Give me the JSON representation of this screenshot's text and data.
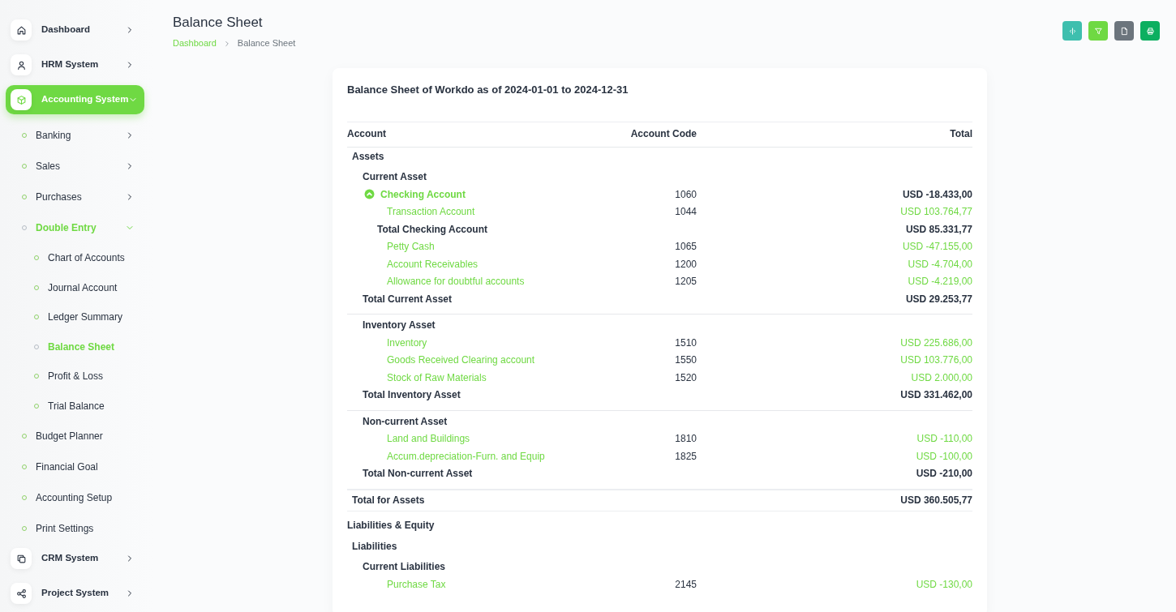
{
  "sidebar": {
    "items": [
      {
        "kind": "module",
        "label": "Dashboard",
        "selected": false,
        "expanded": false
      },
      {
        "kind": "module",
        "label": "HRM System",
        "selected": false,
        "expanded": false
      },
      {
        "kind": "module",
        "label": "Accounting System",
        "selected": true,
        "expanded": true,
        "children": [
          {
            "label": "Banking",
            "selected": false,
            "expanded": false
          },
          {
            "label": "Sales",
            "selected": false,
            "expanded": false
          },
          {
            "label": "Purchases",
            "selected": false,
            "expanded": false
          },
          {
            "label": "Double Entry",
            "selected": true,
            "expanded": true,
            "children": [
              {
                "label": "Chart of Accounts",
                "selected": false
              },
              {
                "label": "Journal Account",
                "selected": false
              },
              {
                "label": "Ledger Summary",
                "selected": false
              },
              {
                "label": "Balance Sheet",
                "selected": true
              },
              {
                "label": "Profit & Loss",
                "selected": false
              },
              {
                "label": "Trial Balance",
                "selected": false
              }
            ]
          },
          {
            "label": "Budget Planner",
            "selected": false
          },
          {
            "label": "Financial Goal",
            "selected": false
          },
          {
            "label": "Accounting Setup",
            "selected": false
          },
          {
            "label": "Print Settings",
            "selected": false
          }
        ]
      },
      {
        "kind": "module",
        "label": "CRM System",
        "selected": false,
        "expanded": false
      },
      {
        "kind": "module",
        "label": "Project System",
        "selected": false,
        "expanded": false
      }
    ]
  },
  "page": {
    "title": "Balance Sheet",
    "breadcrumb": [
      "Dashboard",
      "Balance Sheet"
    ],
    "actions": [
      {
        "color": "#3ebfae"
      },
      {
        "color": "#6fd943"
      },
      {
        "color": "#6c757d"
      },
      {
        "color": "#0caf60"
      }
    ]
  },
  "report": {
    "title": "Balance Sheet of Workdo as of 2024-01-01 to 2024-12-31",
    "columns": [
      "Account",
      "Account Code",
      "Total"
    ],
    "parts": [
      {
        "kind": "section",
        "title": "Assets",
        "groups": [
          {
            "title": "Current Asset",
            "rows": [
              {
                "kind": "parent",
                "name": "Checking Account",
                "code": "1060",
                "total": "USD -18.433,00",
                "expanded": true,
                "children": [
                  {
                    "kind": "account",
                    "name": "Transaction Account",
                    "code": "1044",
                    "total": "USD 103.764,77"
                  }
                ],
                "total_label": "Total Checking Account",
                "sum": "USD 85.331,77"
              },
              {
                "kind": "account",
                "name": "Petty Cash",
                "code": "1065",
                "total": "USD -47.155,00"
              },
              {
                "kind": "account",
                "name": "Account Receivables",
                "code": "1200",
                "total": "USD -4.704,00"
              },
              {
                "kind": "account",
                "name": "Allowance for doubtful accounts",
                "code": "1205",
                "total": "USD -4.219,00"
              }
            ],
            "total_label": "Total Current Asset",
            "total": "USD 29.253,77"
          },
          {
            "title": "Inventory Asset",
            "rows": [
              {
                "kind": "account",
                "name": "Inventory",
                "code": "1510",
                "total": "USD 225.686,00"
              },
              {
                "kind": "account",
                "name": "Goods Received Clearing account",
                "code": "1550",
                "total": "USD 103.776,00"
              },
              {
                "kind": "account",
                "name": "Stock of Raw Materials",
                "code": "1520",
                "total": "USD 2.000,00"
              }
            ],
            "total_label": "Total Inventory Asset",
            "total": "USD 331.462,00"
          },
          {
            "title": "Non-current Asset",
            "rows": [
              {
                "kind": "account",
                "name": "Land and Buildings",
                "code": "1810",
                "total": "USD -110,00"
              },
              {
                "kind": "account",
                "name": "Accum.depreciation-Furn. and Equip",
                "code": "1825",
                "total": "USD -100,00"
              }
            ],
            "total_label": "Total Non-current Asset",
            "total": "USD -210,00"
          }
        ],
        "total_label": "Total for Assets",
        "total": "USD 360.505,77"
      },
      {
        "kind": "heading",
        "title": "Liabilities & Equity"
      },
      {
        "kind": "section",
        "title": "Liabilities",
        "groups": [
          {
            "title": "Current Liabilities",
            "rows": [
              {
                "kind": "account",
                "name": "Purchase Tax",
                "code": "2145",
                "total": "USD -130,00"
              }
            ]
          }
        ]
      }
    ]
  }
}
